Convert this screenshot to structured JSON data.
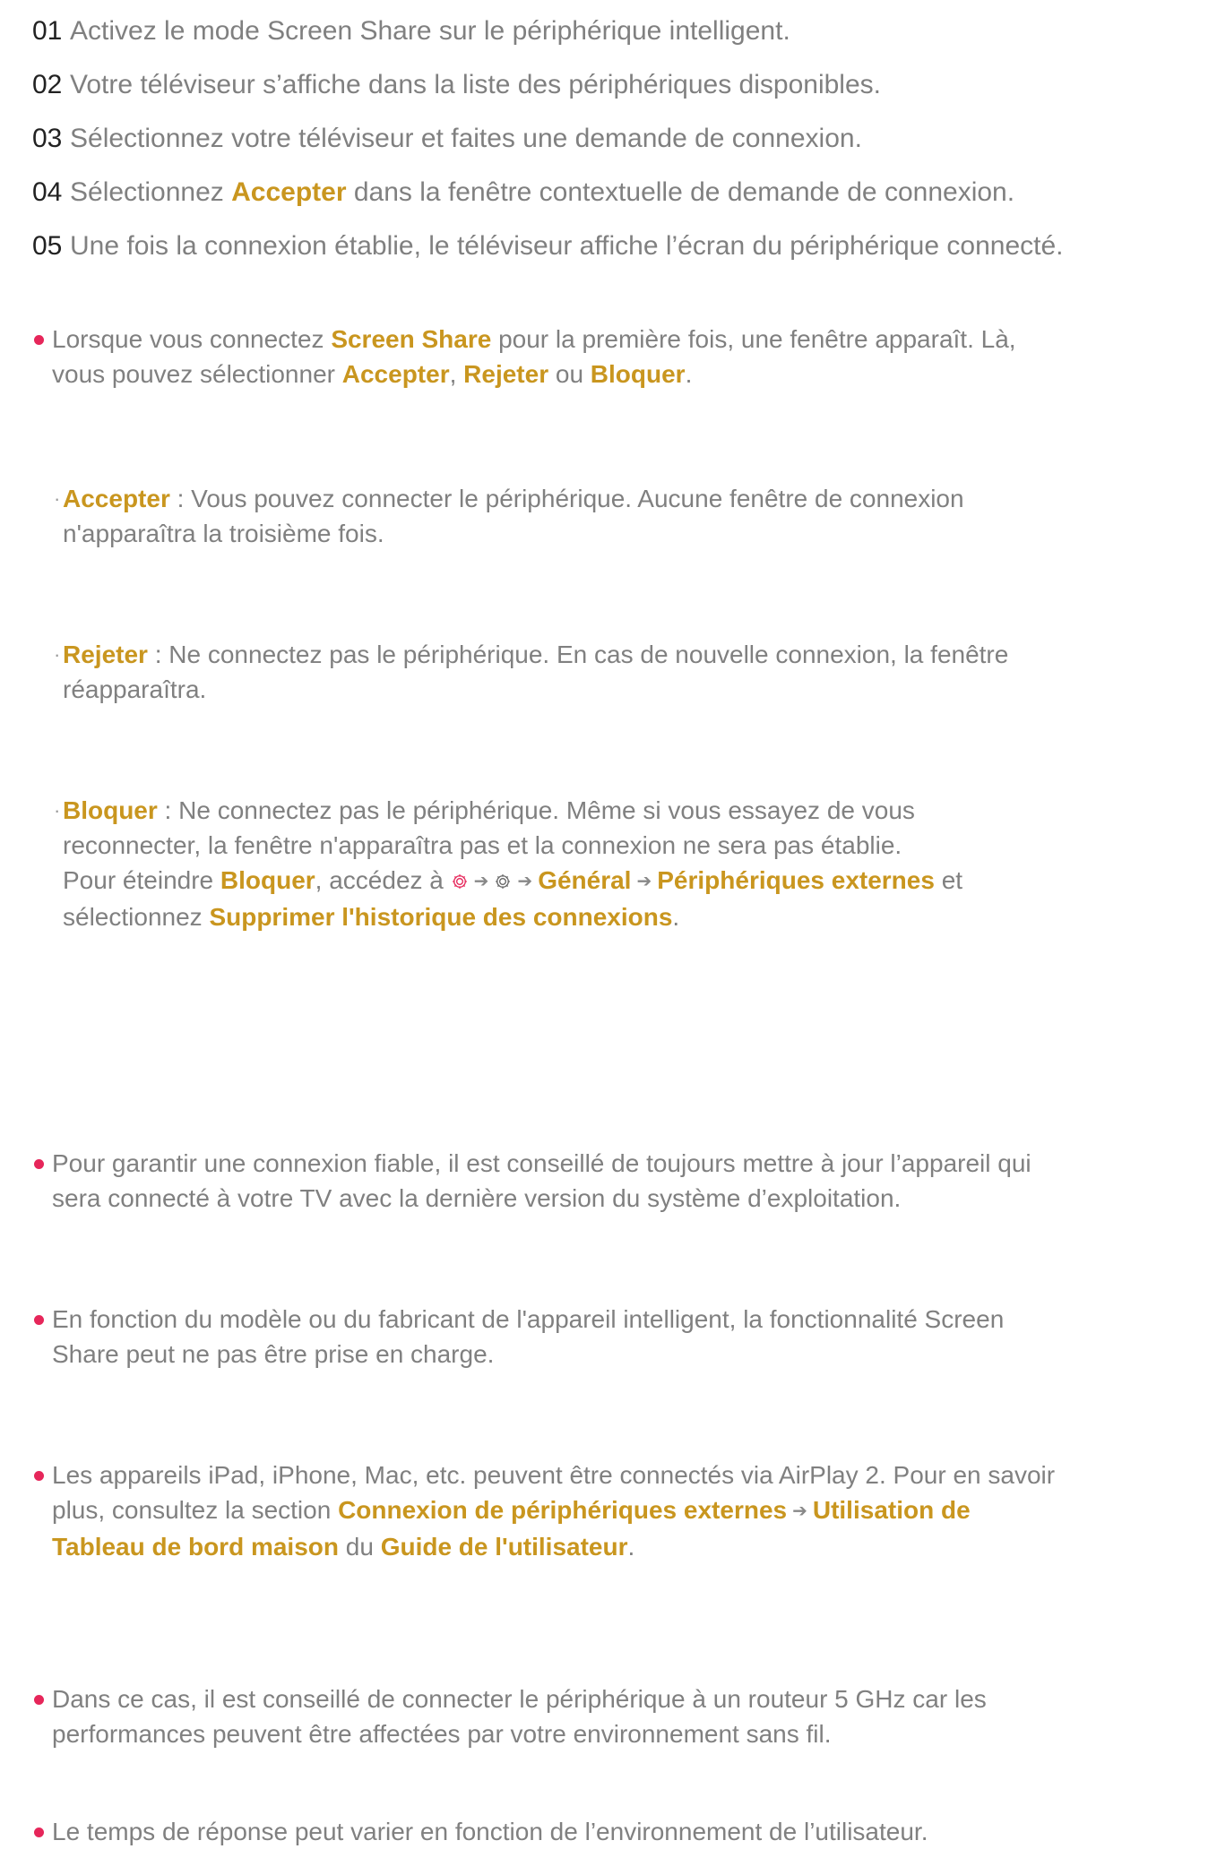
{
  "colors": {
    "accent": "#c9961f",
    "bullet": "#e6265a",
    "text": "#808080",
    "step_number": "#222222"
  },
  "steps": [
    {
      "num": "01",
      "text": "Activez le mode Screen Share sur le périphérique intelligent."
    },
    {
      "num": "02",
      "text": "Votre téléviseur s’affiche dans la liste des périphériques disponibles."
    },
    {
      "num": "03",
      "text": "Sélectionnez votre téléviseur et faites une demande de connexion."
    },
    {
      "num": "04",
      "pre": "Sélectionnez ",
      "bold": "Accepter",
      "post": " dans la fenêtre contextuelle de demande de connexion."
    },
    {
      "num": "05",
      "text": "Une fois la connexion établie, le téléviseur affiche l’écran du périphérique connecté."
    }
  ],
  "first_note": {
    "t1": "Lorsque vous connectez ",
    "b1": "Screen Share",
    "t2": " pour la première fois, une fenêtre apparaît. Là,",
    "t3": "vous pouvez sélectionner ",
    "b2": "Accepter",
    "t4": ", ",
    "b3": "Rejeter",
    "t5": " ou ",
    "b4": "Bloquer",
    "t6": "."
  },
  "options": {
    "accept": {
      "label": "Accepter",
      "l1": " : Vous pouvez connecter le périphérique. Aucune fenêtre de connexion",
      "l2": "n'apparaîtra la troisième fois."
    },
    "reject": {
      "label": "Rejeter",
      "l1": " : Ne connectez pas le périphérique. En cas de nouvelle connexion, la fenêtre",
      "l2": "réapparaîtra."
    },
    "block": {
      "label": "Bloquer",
      "l1": " : Ne connectez pas le périphérique. Même si vous essayez de vous",
      "l2": "reconnecter, la fenêtre n'apparaîtra pas et la connexion ne sera pas établie.",
      "l3a": "Pour éteindre ",
      "l3b": "Bloquer",
      "l3c": ", accédez à ",
      "path1": "Général",
      "path2": "Périphériques externes",
      "l3d": " et",
      "l4a": "sélectionnez ",
      "l4b": "Supprimer l'historique des connexions",
      "l4c": "."
    }
  },
  "arrow": "➔",
  "notes": {
    "n1": {
      "l1": "Pour garantir une connexion fiable, il est conseillé de toujours mettre à jour l’appareil qui",
      "l2": "sera connecté à votre TV avec la dernière version du système d’exploitation."
    },
    "n2": {
      "l1": "En fonction du modèle ou du fabricant de l'appareil intelligent, la fonctionnalité Screen",
      "l2": "Share peut ne pas être prise en charge."
    },
    "n3": {
      "l1": "Les appareils iPad, iPhone, Mac, etc. peuvent être connectés via AirPlay 2. Pour en savoir",
      "l2a": "plus, consultez la section ",
      "b1": "Connexion de périphériques externes",
      "b2": "Utilisation de",
      "b3": "Tableau de bord maison",
      "t1": " du ",
      "b4": "Guide de l'utilisateur",
      "t2": "."
    },
    "n4": {
      "l1": "Dans ce cas, il est conseillé de connecter le périphérique à un routeur 5 GHz car les",
      "l2": "performances peuvent être affectées par votre environnement sans fil."
    },
    "n5": {
      "l1": "Le temps de réponse peut varier en fonction de l’environnement de l’utilisateur."
    }
  }
}
